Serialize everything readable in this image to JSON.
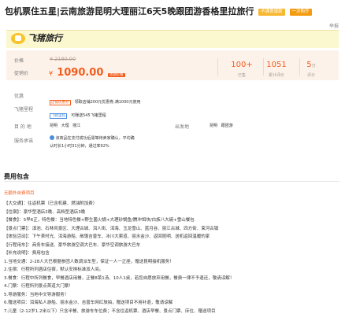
{
  "title": {
    "text": "包机票住五星|云南旅游昆明大理丽江6天5晚跟团游香格里拉旅行",
    "tags": [
      "不满意退款",
      "一次购齐"
    ]
  },
  "share_label": "举报",
  "logo_text": "飞猪旅行",
  "price": {
    "original_label": "价格",
    "original_value": "¥ 2180.00",
    "current_label": "促销价",
    "currency": "¥",
    "current_value": "1090.00",
    "badge": "活动价格"
  },
  "stats": [
    {
      "value": "100+",
      "label": "已售"
    },
    {
      "value": "1051",
      "label": "累计评价"
    },
    {
      "value": "5",
      "unit": "分",
      "label": "评分"
    }
  ],
  "promo": {
    "label": "优惠",
    "tag": "店铺优惠券",
    "text": "领取店铺200元优惠券,满1000元使用"
  },
  "points": {
    "label": "飞猪里程",
    "tag": "飞猪里程",
    "text": "可赚送545飞猪里程"
  },
  "destination": {
    "label": "目 的 地",
    "values": [
      "昆明",
      "大理",
      "丽江"
    ],
    "origin_label": "出发地",
    "origin_values": [
      "昆明",
      "跟团游"
    ]
  },
  "service": {
    "label": "服务承诺",
    "line1": "该商品在支付成功后需等待卖家确认，平均确",
    "line2": "认时长1小时31分钟，通过率92%"
  },
  "package_title": "费用包含",
  "package_sub": "无额外自费项目",
  "package_lines": [
    "【大交通】：往返机票（已含机建、燃油附加费）",
    "【住宿】：豪华型酒店2晚、高档型酒店3晚",
    "【餐食】：5早6正，特色餐：当地特色餐+野生菌火锅+大理砂锅鱼/腾冲饵块/白族八大碗+雪山餐包",
    "【景点门票】：滇池、石林风景区、大理古城、洱人街、洱海、玉龙雪山、蓝月谷、丽江古城、四方街、束河古镇",
    "【体验活动】：下午茶时光、洱海游船、敞篷吉普车、冰川大索道、丽水金沙、返回昆明、送机返回温暖的家",
    "【行程用车】：商务车接送、豪华旅游空调大巴车、豪华空调旅游大巴车",
    "【补充说明】：费用包含",
    "1.当地交通：2-28人大巴根据参团人数调派车型，保证一人一正座，赠送昆明接机服务！",
    "2.住宿：行程所列酒店住宿，默认安排标准双人间。",
    "3.餐食：行程中所列餐食，早餐酒店用餐，正餐8菜1汤、10人1桌，若您自愿放弃用餐，餐费一律不予退还，敬请谅解！",
    "4.门票：行程所列景点首道大门票！",
    "5.导游服务：当地中文导游服务！",
    "6.赠送项目：洱海私人游船、丽水金沙、吉普车网红旅拍，赠送项目不用补退，敬请谅解",
    "7.儿童（2-12岁1.2米以下）只含半餐、旅游车车位费；不含往返机票、酒店早餐、景点门票、床位、赠送项目"
  ],
  "colors": {
    "accent": "#f25c1c",
    "header_band": "#fbf7cf",
    "info_band": "#fdf2ea",
    "badge_blue": "#4a8de0"
  }
}
